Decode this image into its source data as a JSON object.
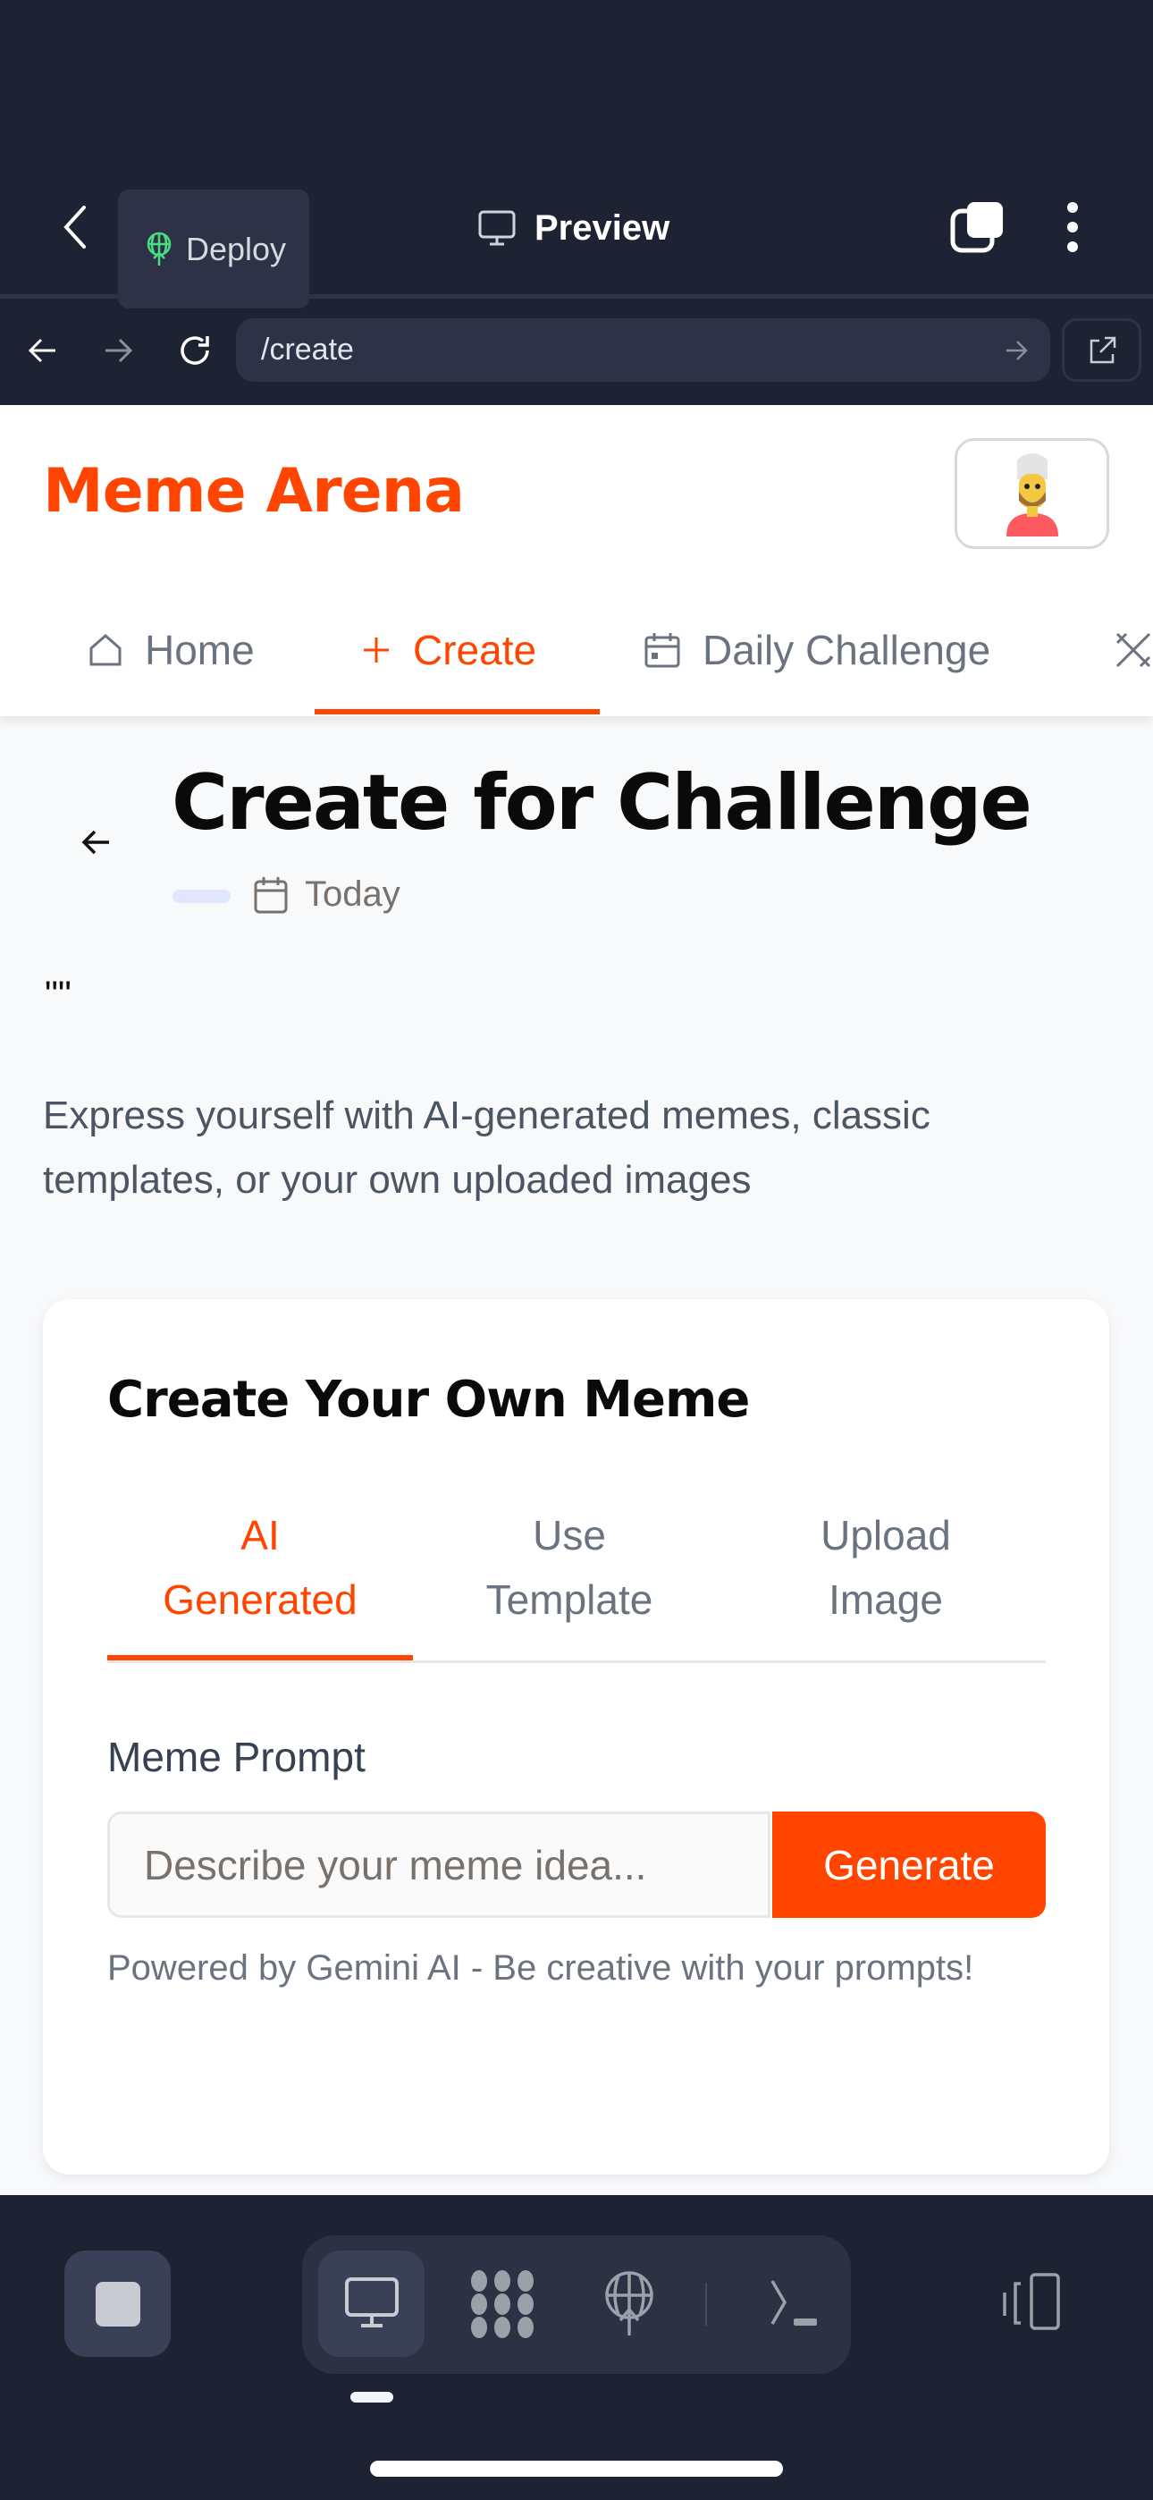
{
  "browser": {
    "deploy_label": "Deploy",
    "preview_label": "Preview",
    "url": "/create"
  },
  "app": {
    "logo": "Meme Arena",
    "nav": [
      {
        "label": "Home",
        "icon": "home-icon"
      },
      {
        "label": "Create",
        "icon": "plus-icon",
        "active": true
      },
      {
        "label": "Daily Challenge",
        "icon": "calendar-icon"
      }
    ]
  },
  "page": {
    "title": "Create for Challenge",
    "date_label": "Today",
    "quote": "\"\"",
    "description": "Express yourself with AI-generated memes, classic templates, or your own uploaded images"
  },
  "card": {
    "title": "Create Your Own Meme",
    "tabs": [
      {
        "line1": "AI",
        "line2": "Generated",
        "active": true
      },
      {
        "line1": "Use",
        "line2": "Template"
      },
      {
        "line1": "Upload",
        "line2": "Image"
      }
    ],
    "prompt_label": "Meme Prompt",
    "prompt_placeholder": "Describe your meme idea...",
    "generate_label": "Generate",
    "helper": "Powered by Gemini AI - Be creative with your prompts!"
  },
  "colors": {
    "accent": "#ff4500",
    "dark_bg": "#1e2334",
    "page_bg": "#f8f9fb"
  }
}
